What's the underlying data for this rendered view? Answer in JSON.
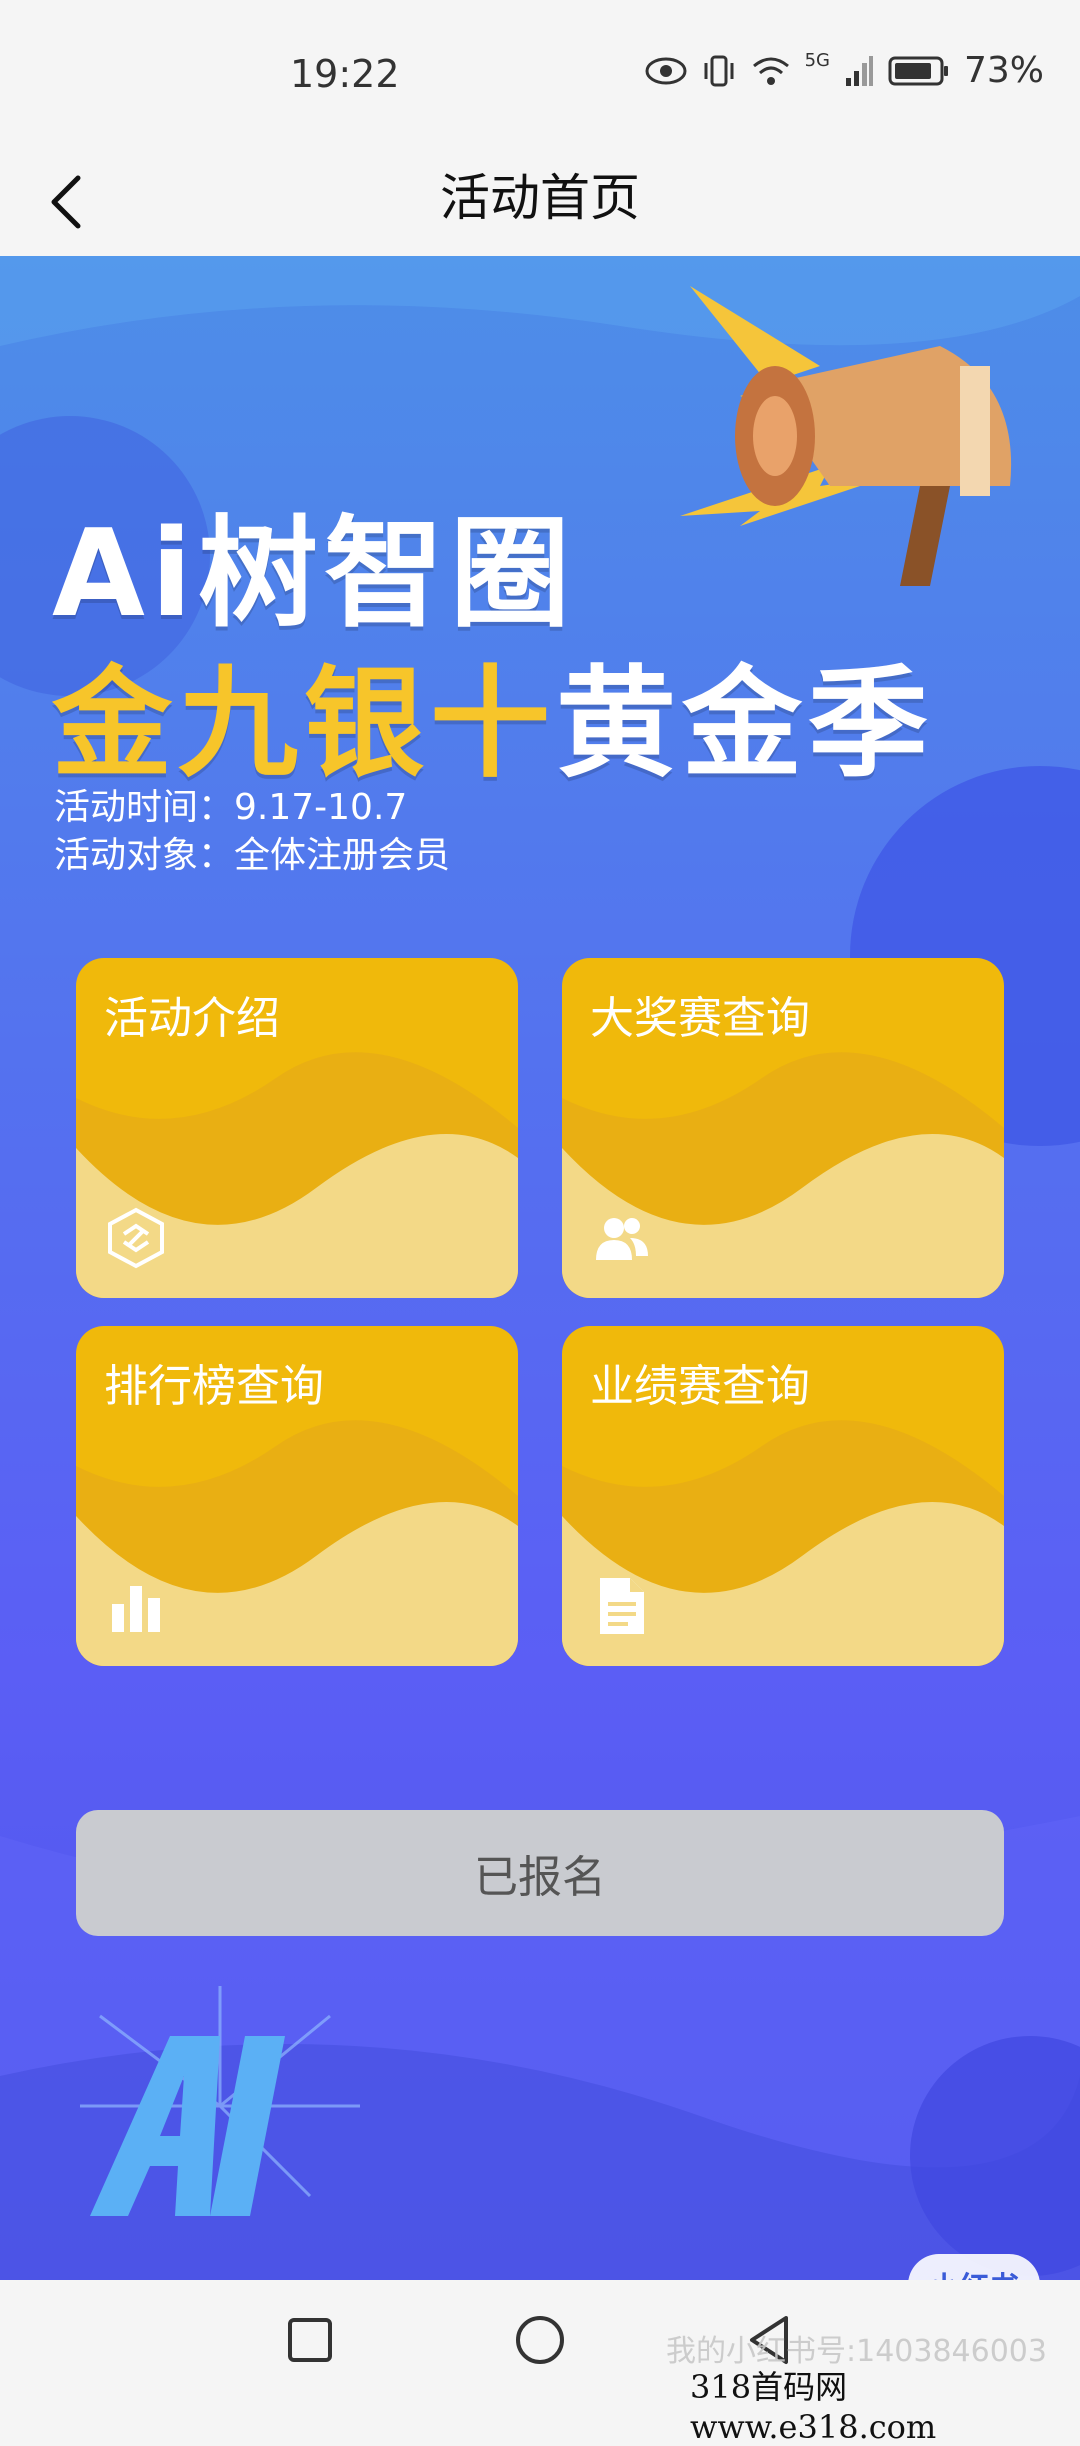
{
  "status": {
    "time": "19:22",
    "battery": "73%",
    "network": "5G"
  },
  "header": {
    "title": "活动首页"
  },
  "banner": {
    "brand": "Ai树智圈",
    "slogan_gold": "金九银十",
    "slogan_white": "黄金季"
  },
  "info": {
    "time_line": "活动时间：9.17-10.7",
    "target_line": "活动对象：全体注册会员"
  },
  "cards": [
    {
      "label": "活动介绍",
      "icon": "link-hexagon-icon"
    },
    {
      "label": "大奖赛查询",
      "icon": "users-icon"
    },
    {
      "label": "排行榜查询",
      "icon": "bar-chart-icon"
    },
    {
      "label": "业绩赛查询",
      "icon": "document-icon"
    }
  ],
  "signup": {
    "label": "已报名"
  },
  "watermark": {
    "badge": "小红书",
    "account": "我的小红书号:1403846003",
    "site": "318首码网  www.e318.com"
  },
  "colors": {
    "card": "#f0b90b",
    "gold_text": "#f7c52a",
    "button_disabled": "#c9cbd0"
  }
}
